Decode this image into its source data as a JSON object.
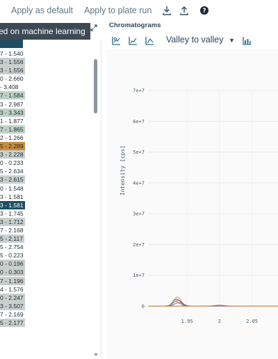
{
  "toolbar": {
    "apply_default": "Apply as default",
    "apply_plate": "Apply to plate run",
    "download_icon": "download-icon",
    "upload_icon": "upload-icon",
    "help_icon": "help-icon"
  },
  "tooltip": {
    "text": "ed on machine learning"
  },
  "left_panel": {
    "rows": [
      {
        "text": "7 - 1.540",
        "style": ""
      },
      {
        "text": "3 - 1.556",
        "style": "hl-gray"
      },
      {
        "text": "3 - 1.556",
        "style": "hl-gray"
      },
      {
        "text": "0 - 2.660",
        "style": ""
      },
      {
        "text": "- 3.408",
        "style": ""
      },
      {
        "text": "7 - 1.584",
        "style": "hl-green"
      },
      {
        "text": "3 - 2.987",
        "style": ""
      },
      {
        "text": "3 - 3.343",
        "style": "hl-green"
      },
      {
        "text": "1 - 1.877",
        "style": ""
      },
      {
        "text": "7 - 1.865",
        "style": "hl-green"
      },
      {
        "text": "2 - 1.266",
        "style": ""
      },
      {
        "text": "5 - 2.289",
        "style": "hl-orange"
      },
      {
        "text": "3 - 2.228",
        "style": "hl-gray"
      },
      {
        "text": "0 - 0.233",
        "style": ""
      },
      {
        "text": "5 - 2.634",
        "style": ""
      },
      {
        "text": "3 - 2.615",
        "style": "hl-gray"
      },
      {
        "text": "0 - 1.548",
        "style": ""
      },
      {
        "text": "3 - 1.581",
        "style": ""
      },
      {
        "text": "3 - 1.581",
        "style": "hl-dark"
      },
      {
        "text": "3 - 1.745",
        "style": ""
      },
      {
        "text": "3 - 1.712",
        "style": "hl-gray"
      },
      {
        "text": "7 - 2.168",
        "style": ""
      },
      {
        "text": "5 - 2.117",
        "style": "hl-gray"
      },
      {
        "text": "5 - 2.754",
        "style": ""
      },
      {
        "text": "5 - 0.223",
        "style": ""
      },
      {
        "text": "0 - 0.196",
        "style": "hl-gray"
      },
      {
        "text": "0 - 0.303",
        "style": "hl-gray"
      },
      {
        "text": "7 - 1.196",
        "style": "hl-gray"
      },
      {
        "text": "4 - 1.576",
        "style": ""
      },
      {
        "text": "0 - 2.247",
        "style": "hl-gray"
      },
      {
        "text": "3 - 3.507",
        "style": "hl-gray"
      },
      {
        "text": "7 - 2.169",
        "style": ""
      },
      {
        "text": "5 - 2.177",
        "style": "hl-gray"
      }
    ]
  },
  "chromatograms": {
    "title": "Chromatograms",
    "integration_mode": "Valley to valley",
    "chart_data": {
      "type": "line",
      "xlabel": "",
      "ylabel": "Intensity [cps]",
      "x_ticks": [
        "1.95",
        "2",
        "2.05"
      ],
      "y_ticks": [
        "0",
        "1e+7",
        "2e+7",
        "3e+7",
        "4e+7",
        "5e+7",
        "6e+7",
        "7e+7"
      ],
      "ylim": [
        0,
        70000000
      ],
      "xlim": [
        1.89,
        2.09
      ],
      "series": [
        {
          "color": "#e0a13a",
          "peak_x": 1.935,
          "peak_y": 3000000,
          "width": 0.008
        },
        {
          "color": "#3b6fb6",
          "peak_x": 1.934,
          "peak_y": 2300000,
          "width": 0.008
        },
        {
          "color": "#c0504d",
          "peak_x": 1.936,
          "peak_y": 1900000,
          "width": 0.009
        },
        {
          "color": "#9bbb59",
          "peak_x": 1.933,
          "peak_y": 1500000,
          "width": 0.008
        },
        {
          "color": "#8064a2",
          "peak_x": 1.937,
          "peak_y": 1100000,
          "width": 0.009
        },
        {
          "color": "#b5651d",
          "peak_x": 2.0,
          "peak_y": 300000,
          "width": 0.01
        }
      ]
    }
  }
}
